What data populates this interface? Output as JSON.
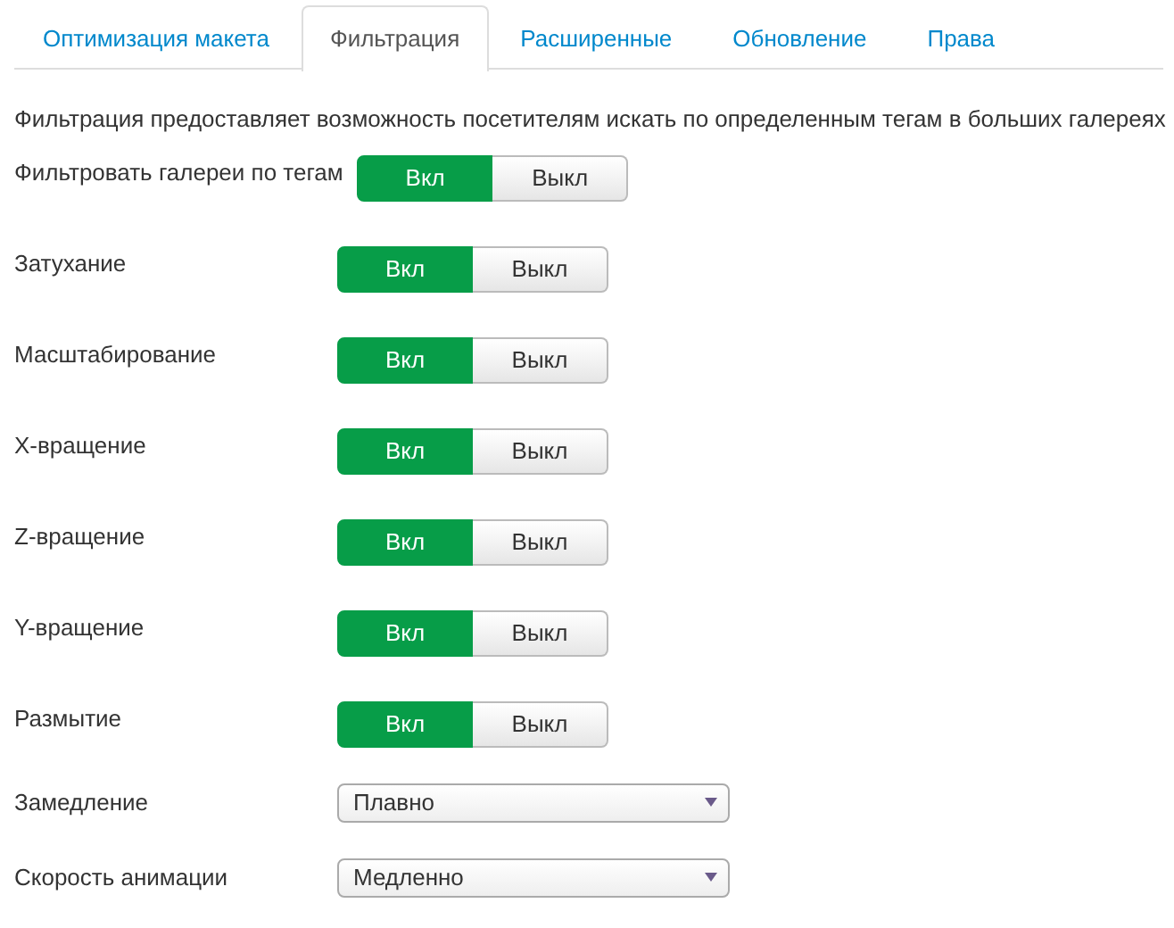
{
  "tabs": [
    {
      "label": "Оптимизация макета",
      "selected": false
    },
    {
      "label": "Фильтрация",
      "selected": true
    },
    {
      "label": "Расширенные",
      "selected": false
    },
    {
      "label": "Обновление",
      "selected": false
    },
    {
      "label": "Права",
      "selected": false
    }
  ],
  "description": "Фильтрация предоставляет возможность посетителям искать по определенным тегам в больших галереях",
  "settings": [
    {
      "kind": "toggle",
      "label": "Фильтровать галереи по тегам",
      "options": [
        {
          "label": "Вкл",
          "selected": true
        },
        {
          "label": "Выкл",
          "selected": false
        }
      ]
    },
    {
      "kind": "toggle",
      "label": "Затухание",
      "options": [
        {
          "label": "Вкл",
          "selected": true
        },
        {
          "label": "Выкл",
          "selected": false
        }
      ]
    },
    {
      "kind": "toggle",
      "label": "Масштабирование",
      "options": [
        {
          "label": "Вкл",
          "selected": true
        },
        {
          "label": "Выкл",
          "selected": false
        }
      ]
    },
    {
      "kind": "toggle",
      "label": "X-вращение",
      "options": [
        {
          "label": "Вкл",
          "selected": true
        },
        {
          "label": "Выкл",
          "selected": false
        }
      ]
    },
    {
      "kind": "toggle",
      "label": "Z-вращение",
      "options": [
        {
          "label": "Вкл",
          "selected": true
        },
        {
          "label": "Выкл",
          "selected": false
        }
      ]
    },
    {
      "kind": "toggle",
      "label": "Y-вращение",
      "options": [
        {
          "label": "Вкл",
          "selected": true
        },
        {
          "label": "Выкл",
          "selected": false
        }
      ]
    },
    {
      "kind": "toggle",
      "label": "Размытие",
      "options": [
        {
          "label": "Вкл",
          "selected": true
        },
        {
          "label": "Выкл",
          "selected": false
        }
      ]
    },
    {
      "kind": "select",
      "label": "Замедление",
      "value": "Плавно"
    },
    {
      "kind": "select",
      "label": "Скорость анимации",
      "value": "Медленно"
    }
  ]
}
